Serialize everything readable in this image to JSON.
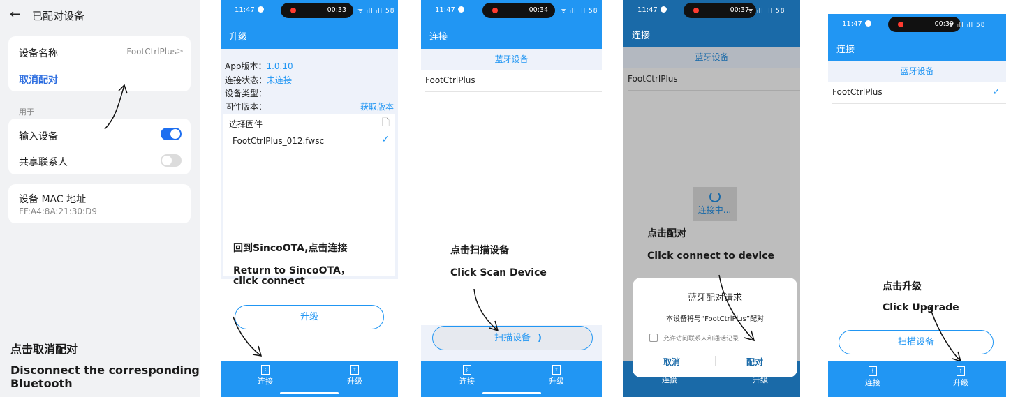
{
  "p1": {
    "back_arrow": "←",
    "title": "已配对设备",
    "device_name_label": "设备名称",
    "device_name_value": "FootCtrlPlus",
    "chevron": ">",
    "unpair": "取消配对",
    "used_for": "用于",
    "input_device": "输入设备",
    "input_device_on": true,
    "share_contacts": "共享联系人",
    "share_contacts_on": false,
    "mac_label": "设备 MAC 地址",
    "mac_value": "FF:A4:8A:21:30:D9",
    "caption_cn": "点击取消配对",
    "caption_en_1": "Disconnect the corresponding",
    "caption_en_2": "Bluetooth"
  },
  "p2": {
    "time": "11:47",
    "pill_time": "00:33",
    "signal": "ᯤ ᵢll ᵢll 58",
    "appbar_title": "升级",
    "app_version_label": "App版本：",
    "app_version_value": "1.0.10",
    "conn_status_label": "连接状态：",
    "conn_status_value": "未连接",
    "device_type_label": "设备类型：",
    "firmware_version_label": "固件版本：",
    "get_version": "获取版本",
    "select_firmware": "选择固件",
    "file_icon": "🗋",
    "firmware_file": "FootCtrlPlus_012.fwsc",
    "check": "✓",
    "caption_cn": "回到SincoOTA,点击连接",
    "caption_en_1": "Return to SincoOTA，",
    "caption_en_2": "click connect",
    "upgrade_button": "升级",
    "tab_connect": "连接",
    "tab_upgrade": "升级"
  },
  "p3": {
    "time": "11:47",
    "pill_time": "00:34",
    "signal": "ᯤ ᵢll ᵢll 58",
    "appbar_title": "连接",
    "section_header": "蓝牙设备",
    "device": "FootCtrlPlus",
    "caption_cn": "点击扫描设备",
    "caption_en": "Click Scan Device",
    "scan_button": "扫描设备",
    "spinner": ")",
    "tab_connect": "连接",
    "tab_upgrade": "升级"
  },
  "p4": {
    "time": "11:47",
    "pill_time": "00:37",
    "signal": "ᯤ ᵢll ᵢll 58",
    "appbar_title": "连接",
    "section_header": "蓝牙设备",
    "device": "FootCtrlPlus",
    "connecting": "连接中...",
    "caption_cn": "点击配对",
    "caption_en": "Click connect to device",
    "dialog_title": "蓝牙配对请求",
    "dialog_msg": "本设备将与“FootCtrlPlus”配对",
    "dialog_checkbox": "允许访问联系人和通话记录",
    "dialog_cancel": "取消",
    "dialog_pair": "配对",
    "tab_connect": "连接",
    "tab_upgrade": "升级"
  },
  "p5": {
    "time": "11:47",
    "pill_time": "00:39",
    "signal": "ᯤ ᵢll ᵢll 58",
    "appbar_title": "连接",
    "section_header": "蓝牙设备",
    "device": "FootCtrlPlus",
    "check": "✓",
    "caption_cn": "点击升级",
    "caption_en": "Click Upgrade",
    "scan_button": "扫描设备",
    "tab_connect": "连接",
    "tab_upgrade": "升级"
  },
  "colors": {
    "accent": "#2196f3",
    "toggle_on": "#1e6ff0",
    "settings_bg": "#f1f2f4"
  }
}
